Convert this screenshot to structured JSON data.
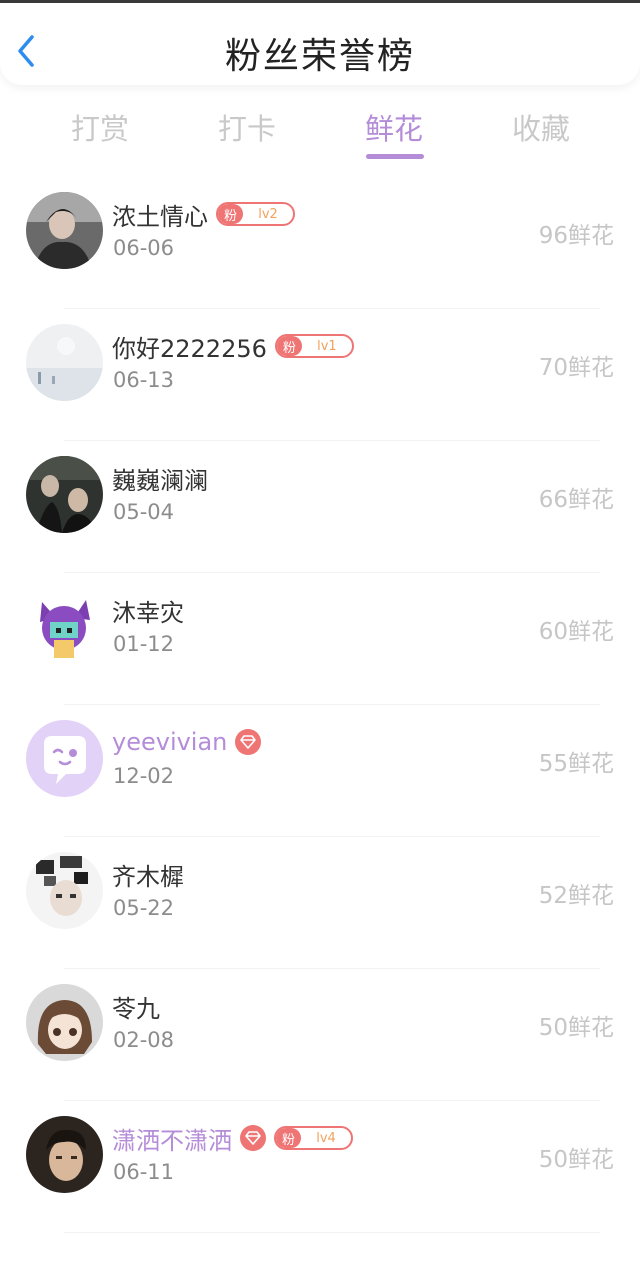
{
  "header": {
    "title": "粉丝荣誉榜"
  },
  "tabs": [
    {
      "label": "打赏"
    },
    {
      "label": "打卡"
    },
    {
      "label": "鲜花"
    },
    {
      "label": "收藏"
    }
  ],
  "active_tab": "鲜花",
  "colors": {
    "accent": "#b48cd8",
    "badge": "#ef7474",
    "badge_level": "#f2a25d"
  },
  "fans": [
    {
      "name": "浓土情心",
      "date": "06-06",
      "value": "96鲜花",
      "fan_label": "粉",
      "level": "lv2",
      "vip": false
    },
    {
      "name": "你好2222256",
      "date": "06-13",
      "value": "70鲜花",
      "fan_label": "粉",
      "level": "lv1",
      "vip": false
    },
    {
      "name": "巍巍澜澜",
      "date": "05-04",
      "value": "66鲜花",
      "vip": false
    },
    {
      "name": "沐幸灾",
      "date": "01-12",
      "value": "60鲜花",
      "vip": false
    },
    {
      "name": "yeevivian",
      "date": "12-02",
      "value": "55鲜花",
      "vip": true
    },
    {
      "name": "齐木樨",
      "date": "05-22",
      "value": "52鲜花",
      "vip": false
    },
    {
      "name": "苓九",
      "date": "02-08",
      "value": "50鲜花",
      "vip": false
    },
    {
      "name": "潇洒不潇洒",
      "date": "06-11",
      "value": "50鲜花",
      "fan_label": "粉",
      "level": "lv4",
      "vip": true
    }
  ]
}
